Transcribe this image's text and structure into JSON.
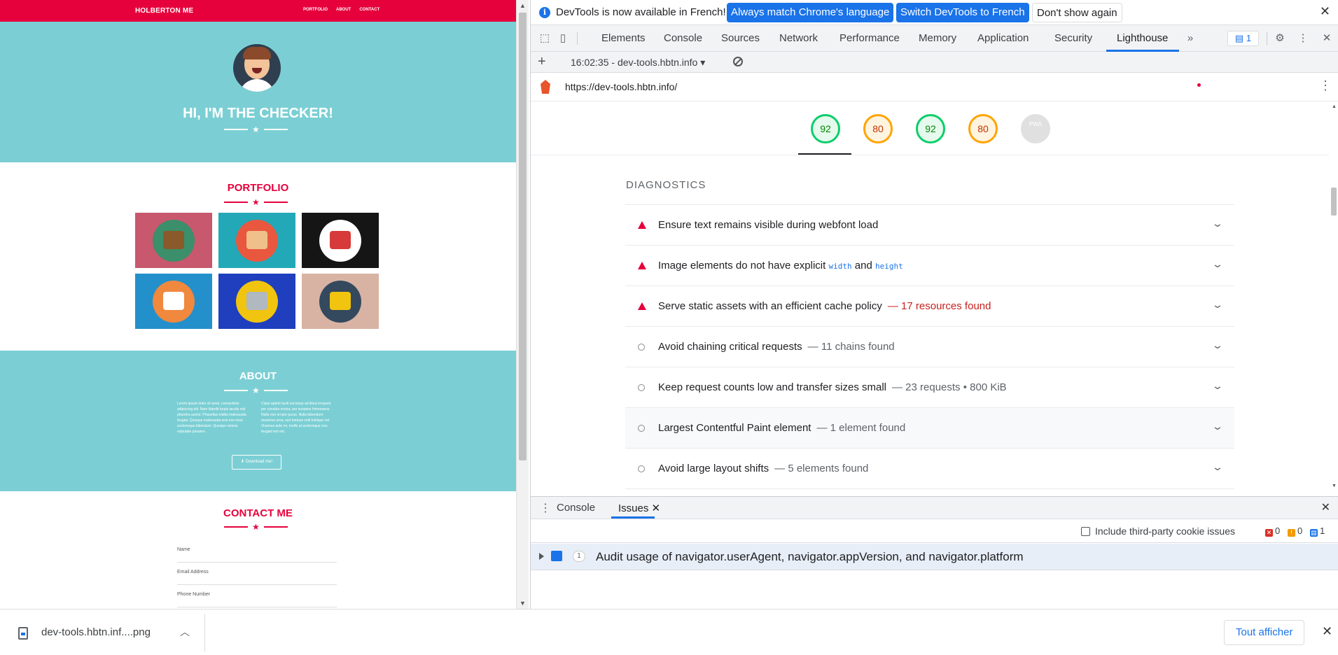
{
  "website": {
    "brand": "HOLBERTON ME",
    "nav_links": [
      "PORTFOLIO",
      "ABOUT",
      "CONTACT"
    ],
    "hero_title": "HI, I'M THE CHECKER!",
    "portfolio_title": "PORTFOLIO",
    "portfolio_tiles": [
      {
        "bg": "#c7586e",
        "disc": "#3b8f6a",
        "obj": "#8b5a2b"
      },
      {
        "bg": "#23a8b8",
        "disc": "#e9573f",
        "obj": "#f0c08a"
      },
      {
        "bg": "#151515",
        "disc": "#ffffff",
        "obj": "#d63a3a"
      },
      {
        "bg": "#2390cc",
        "disc": "#f0883e",
        "obj": "#ffffff"
      },
      {
        "bg": "#1f3fbf",
        "disc": "#f1c40f",
        "obj": "#b0b8c0"
      },
      {
        "bg": "#d8b3a3",
        "disc": "#34495e",
        "obj": "#f1c40f"
      }
    ],
    "about_title": "ABOUT",
    "about_col1": "Lorem ipsum dolor sit amet, consectetur adipiscing elit. Nam blandit turpis iaculis nisl pharetra auctor. Phasellus mattis malesuada feugiat. Quisque malesuada erat non risus scelerisque bibendum. Quisque viverra vulputate posuere.",
    "about_col2": "Class aptent taciti sociosqu ad litora torquent per conubia nostra, per inceptos himenaeos. Nulla non ornare purus. Nulla bibendum maximus urna, sed tempus velit tristique vel. Vivamus ante mi, mollis at scelerisque non, feugiat non est.",
    "download_label": "Download me!",
    "contact_title": "CONTACT ME",
    "contact_fields": [
      "Name",
      "Email Address",
      "Phone Number"
    ]
  },
  "infobar": {
    "message": "DevTools is now available in French!",
    "btn_match": "Always match Chrome's language",
    "btn_switch": "Switch DevTools to French",
    "btn_dismiss": "Don't show again"
  },
  "devtools_tabs": [
    "Elements",
    "Console",
    "Sources",
    "Network",
    "Performance",
    "Memory",
    "Application",
    "Security",
    "Lighthouse"
  ],
  "active_tab": "Lighthouse",
  "issues_badge": "1",
  "lighthouse": {
    "report_selector": "16:02:35 - dev-tools.hbtn.info",
    "url": "https://dev-tools.hbtn.info/",
    "scores": [
      {
        "value": "92",
        "color": "green"
      },
      {
        "value": "80",
        "color": "orange"
      },
      {
        "value": "92",
        "color": "green"
      },
      {
        "value": "80",
        "color": "orange"
      },
      {
        "value": "PWA",
        "color": "gray"
      }
    ],
    "section_title": "DIAGNOSTICS",
    "audits": [
      {
        "status": "fail",
        "title": "Ensure text remains visible during webfont load",
        "display": ""
      },
      {
        "status": "fail",
        "title": "Image elements do not have explicit",
        "code1": "width",
        "mid": "and",
        "code2": "height",
        "display": ""
      },
      {
        "status": "fail",
        "title": "Serve static assets with an efficient cache policy",
        "display": "— 17 resources found",
        "display_color": "red"
      },
      {
        "status": "info",
        "title": "Avoid chaining critical requests",
        "display": "— 11 chains found"
      },
      {
        "status": "info",
        "title": "Keep request counts low and transfer sizes small",
        "display": "— 23 requests • 800 KiB"
      },
      {
        "status": "info",
        "title": "Largest Contentful Paint element",
        "display": "— 1 element found"
      },
      {
        "status": "info",
        "title": "Avoid large layout shifts",
        "display": "— 5 elements found"
      }
    ]
  },
  "drawer": {
    "tabs": [
      "Console",
      "Issues"
    ],
    "active": "Issues",
    "checkbox_label": "Include third-party cookie issues",
    "counts": {
      "errors": "0",
      "warnings": "0",
      "info": "1"
    },
    "issue_count": "1",
    "issue_text": "Audit usage of navigator.userAgent, navigator.appVersion, and navigator.platform"
  },
  "download_shelf": {
    "filename": "dev-tools.hbtn.inf....png",
    "show_all": "Tout afficher"
  }
}
